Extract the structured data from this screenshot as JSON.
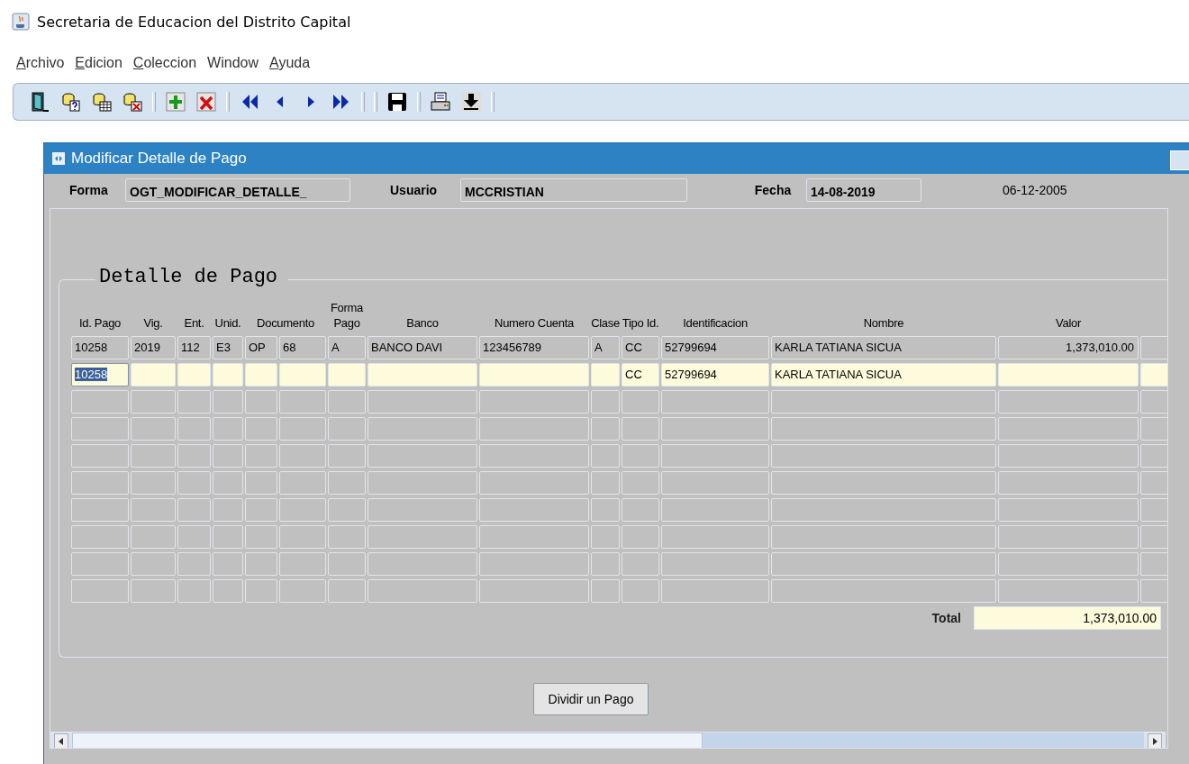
{
  "window": {
    "title": "Secretaria de Educacion del Distrito Capital"
  },
  "menu": [
    {
      "label": "Archivo",
      "mnemonic": true
    },
    {
      "label": "Edicion",
      "mnemonic": true
    },
    {
      "label": "Coleccion",
      "mnemonic": true
    },
    {
      "label": "Window",
      "mnemonic": false
    },
    {
      "label": "Ayuda",
      "mnemonic": true
    }
  ],
  "form_window": {
    "title": "Modificar Detalle de Pago",
    "header": {
      "forma_label": "Forma",
      "forma_value": "OGT_MODIFICAR_DETALLE_",
      "usuario_label": "Usuario",
      "usuario_value": "MCCRISTIAN",
      "fecha_label": "Fecha",
      "fecha_value": "14-08-2019",
      "date": "06-12-2005"
    },
    "section_title": "Detalle de Pago",
    "table": {
      "columns": [
        {
          "label": "Id. Pago"
        },
        {
          "label": "Vig."
        },
        {
          "label": "Ent."
        },
        {
          "label": "Unid."
        },
        {
          "label": "Documento"
        },
        {},
        {
          "label": "Forma Pago"
        },
        {
          "label": "Banco"
        },
        {
          "label": "Numero Cuenta"
        },
        {
          "label": "Clase"
        },
        {
          "label": "Tipo Id."
        },
        {
          "label": "Identificacion"
        },
        {
          "label": "Nombre"
        },
        {
          "label": "Valor"
        },
        {}
      ],
      "rows": [
        {
          "editable": false,
          "focused": false,
          "cells": [
            "10258",
            "2019",
            "112",
            "E3",
            "OP",
            "68",
            "A",
            "BANCO DAVI",
            "123456789",
            "A",
            "CC",
            "52799694",
            "KARLA TATIANA SICUA",
            "1,373,010.00",
            null
          ]
        },
        {
          "editable": true,
          "focused": true,
          "cells": [
            "10258",
            null,
            null,
            null,
            null,
            null,
            null,
            null,
            null,
            null,
            "CC",
            "52799694",
            "KARLA TATIANA SICUA",
            null,
            null
          ]
        },
        {
          "editable": false,
          "focused": false,
          "cells": [
            null,
            null,
            null,
            null,
            null,
            null,
            null,
            null,
            null,
            null,
            null,
            null,
            null,
            null,
            null
          ]
        },
        {
          "editable": false,
          "focused": false,
          "cells": [
            null,
            null,
            null,
            null,
            null,
            null,
            null,
            null,
            null,
            null,
            null,
            null,
            null,
            null,
            null
          ]
        },
        {
          "editable": false,
          "focused": false,
          "cells": [
            null,
            null,
            null,
            null,
            null,
            null,
            null,
            null,
            null,
            null,
            null,
            null,
            null,
            null,
            null
          ]
        },
        {
          "editable": false,
          "focused": false,
          "cells": [
            null,
            null,
            null,
            null,
            null,
            null,
            null,
            null,
            null,
            null,
            null,
            null,
            null,
            null,
            null
          ]
        },
        {
          "editable": false,
          "focused": false,
          "cells": [
            null,
            null,
            null,
            null,
            null,
            null,
            null,
            null,
            null,
            null,
            null,
            null,
            null,
            null,
            null
          ]
        },
        {
          "editable": false,
          "focused": false,
          "cells": [
            null,
            null,
            null,
            null,
            null,
            null,
            null,
            null,
            null,
            null,
            null,
            null,
            null,
            null,
            null
          ]
        },
        {
          "editable": false,
          "focused": false,
          "cells": [
            null,
            null,
            null,
            null,
            null,
            null,
            null,
            null,
            null,
            null,
            null,
            null,
            null,
            null,
            null
          ]
        },
        {
          "editable": false,
          "focused": false,
          "cells": [
            null,
            null,
            null,
            null,
            null,
            null,
            null,
            null,
            null,
            null,
            null,
            null,
            null,
            null,
            null
          ]
        }
      ]
    },
    "total_label": "Total",
    "total_value": "1,373,010.00",
    "button": "Dividir un Pago"
  }
}
